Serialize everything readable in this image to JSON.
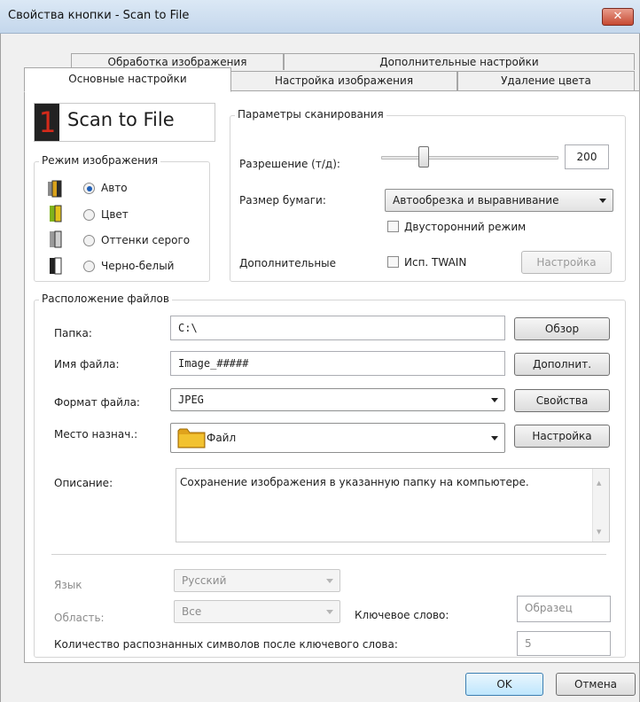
{
  "window": {
    "title": "Свойства кнопки - Scan to File",
    "close": "✕"
  },
  "tabs": {
    "row1": [
      "Обработка изображения",
      "Дополнительные настройки"
    ],
    "row2": [
      "Основные настройки",
      "Настройка изображения",
      "Удаление цвета"
    ],
    "active": "Основные настройки"
  },
  "button_name": {
    "digit": "1",
    "label": "Scan to File"
  },
  "image_mode": {
    "title": "Режим изображения",
    "options": [
      "Авто",
      "Цвет",
      "Оттенки серого",
      "Черно-белый"
    ],
    "selected": "Авто",
    "icon_colors": [
      "#d9a21b",
      "#e3c21c",
      "#9a9a9a",
      "#222222"
    ]
  },
  "scan_params": {
    "title": "Параметры сканирования",
    "resolution_label": "Разрешение (т/д):",
    "resolution_value": "200",
    "resolution_slider_fraction": 0.24,
    "paper_label": "Размер бумаги:",
    "paper_value": "Автообрезка и выравнивание",
    "duplex_label": "Двусторонний режим",
    "duplex_checked": false,
    "advanced_label": "Дополнительные",
    "twain_label": "Исп.  TWAIN",
    "twain_checked": false,
    "setup_button": "Настройка"
  },
  "file_location": {
    "title": "Расположение файлов",
    "folder_label": "Папка:",
    "folder_value": "C:\\",
    "browse_button": "Обзор",
    "filename_label": "Имя файла:",
    "filename_value": "Image_#####",
    "more_button": "Дополнит.",
    "format_label": "Формат файла:",
    "format_value": "JPEG",
    "props_button": "Свойства",
    "dest_label": "Место назнач.:",
    "dest_value": "Файл",
    "dest_button": "Настройка",
    "desc_label": "Описание:",
    "desc_value": "Сохранение изображения в указанную папку на компьютере."
  },
  "ocr": {
    "language_label": "Язык",
    "language_value": "Русский",
    "area_label": "Область:",
    "area_value": "Все",
    "keyword_label": "Ключевое слово:",
    "keyword_value": "Образец",
    "count_label": "Количество распознанных символов после ключевого слова:",
    "count_value": "5"
  },
  "footer": {
    "ok": "OK",
    "cancel": "Отмена"
  },
  "colors": {
    "accent_blue": "#1f5fb7",
    "digit_red": "#d42a1a",
    "folder_yellow": "#f2c230",
    "close_red": "#c64a33"
  }
}
